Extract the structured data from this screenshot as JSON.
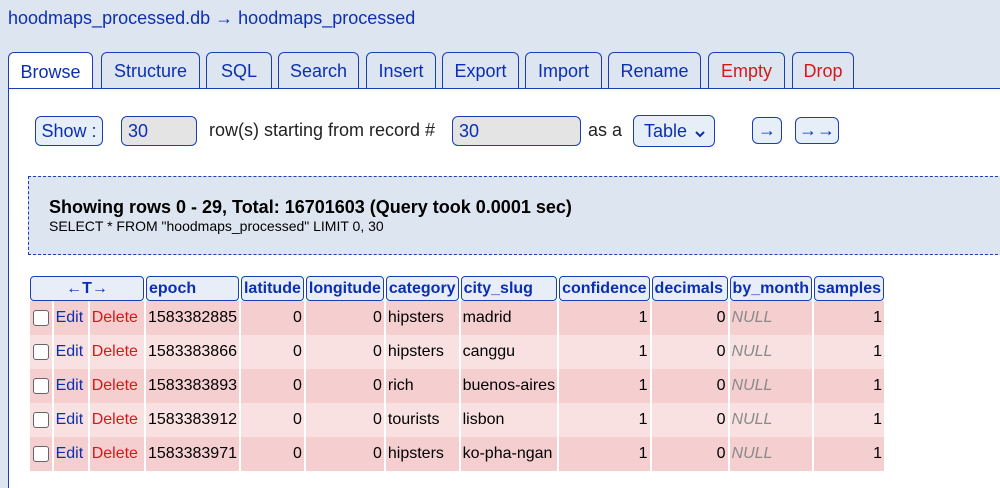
{
  "breadcrumb": {
    "db": "hoodmaps_processed.db",
    "arrow": "→",
    "table": "hoodmaps_processed"
  },
  "tabs": [
    {
      "label": "Browse"
    },
    {
      "label": "Structure"
    },
    {
      "label": "SQL"
    },
    {
      "label": "Search"
    },
    {
      "label": "Insert"
    },
    {
      "label": "Export"
    },
    {
      "label": "Import"
    },
    {
      "label": "Rename"
    },
    {
      "label": "Empty"
    },
    {
      "label": "Drop"
    }
  ],
  "controls": {
    "show_label": "Show :",
    "rows_value": "30",
    "rows_text": "row(s) starting from record #",
    "start_value": "30",
    "as_text": "as a",
    "view_select": "Table",
    "next": "→",
    "last": "→→"
  },
  "info": {
    "summary": "Showing rows 0 - 29, Total: 16701603 (Query took 0.0001 sec)",
    "query": "SELECT * FROM \"hoodmaps_processed\" LIMIT 0, 30"
  },
  "table": {
    "arrows_header": "←T→",
    "columns": [
      "epoch",
      "latitude",
      "longitude",
      "category",
      "city_slug",
      "confidence",
      "decimals",
      "by_month",
      "samples"
    ],
    "edit_label": "Edit",
    "delete_label": "Delete",
    "rows": [
      [
        "1583382885",
        "0",
        "0",
        "hipsters",
        "madrid",
        "1",
        "0",
        "NULL",
        "1"
      ],
      [
        "1583383866",
        "0",
        "0",
        "hipsters",
        "canggu",
        "1",
        "0",
        "NULL",
        "1"
      ],
      [
        "1583383893",
        "0",
        "0",
        "rich",
        "buenos-aires",
        "1",
        "0",
        "NULL",
        "1"
      ],
      [
        "1583383912",
        "0",
        "0",
        "tourists",
        "lisbon",
        "1",
        "0",
        "NULL",
        "1"
      ],
      [
        "1583383971",
        "0",
        "0",
        "hipsters",
        "ko-pha-ngan",
        "1",
        "0",
        "NULL",
        "1"
      ]
    ]
  },
  "colors": {
    "link": "#0b2fb3",
    "danger": "#d21a1a",
    "row_odd": "#f5cfcf",
    "row_even": "#f9e1e1"
  }
}
